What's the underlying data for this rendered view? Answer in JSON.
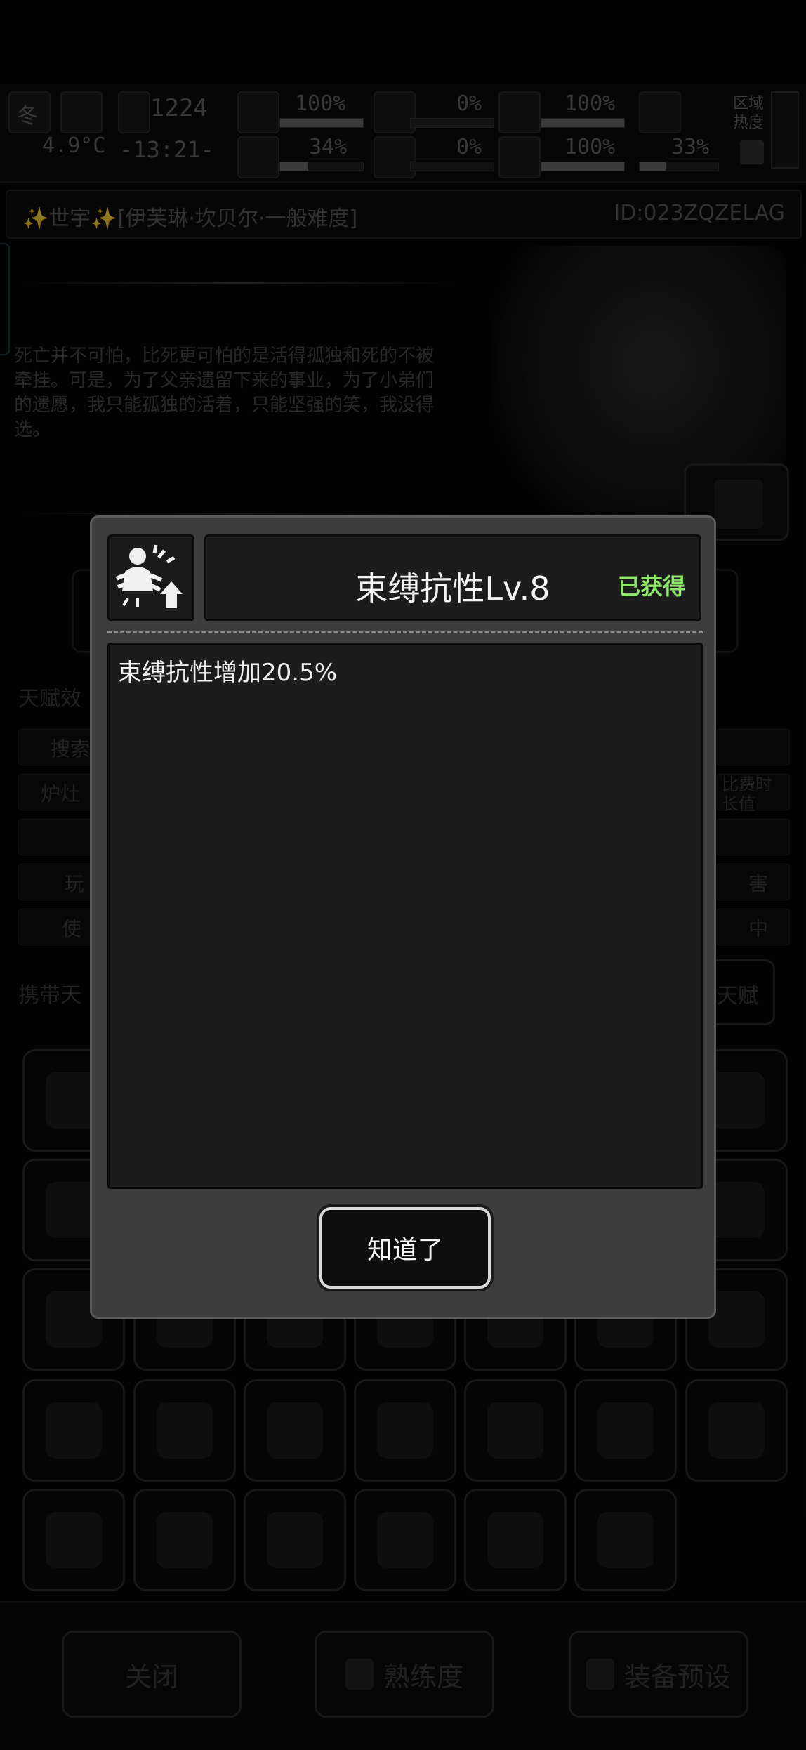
{
  "hud": {
    "season": "冬",
    "temperature": "4.9°C",
    "day": "1224",
    "time": "-13:21-",
    "stats_row1": [
      "100%",
      "0%",
      "100%"
    ],
    "stats_row2": [
      "34%",
      "0%",
      "100%",
      "33%"
    ],
    "region_heat_label": "区域热度",
    "levels": {
      "health": 1.0,
      "hunger": 0.0,
      "stamina": 1.0,
      "mental": 0.34,
      "blood": 0.0,
      "heart": 1.0,
      "defense": 0.33
    }
  },
  "header": {
    "title": "✨世宇✨[伊芙琳·坎贝尔·一般难度]",
    "player_id": "ID:023ZQZELAG"
  },
  "story": {
    "text": "死亡并不可怕，比死更可怕的是活得孤独和死的不被牵挂。可是，为了父亲遗留下来的事业，为了小弟们的遗愿，我只能孤独的活着，只能坚强的笑，我没得选。"
  },
  "background_labels": {
    "talent_effects": "天赋效",
    "row1": "搜索",
    "row2": "炉灶",
    "row2_right": "比费时长值",
    "row4": "玩",
    "row4_right": "害",
    "row5": "使",
    "row5_right": "中",
    "carried_talents": "携带天",
    "talent_button": "天赋"
  },
  "bottom_bar": {
    "close": "关闭",
    "proficiency": "熟练度",
    "equip_preset": "装备预设"
  },
  "modal": {
    "title": "束缚抗性Lv.8",
    "status": "已获得",
    "description": "束缚抗性增加20.5%",
    "confirm": "知道了"
  },
  "colors": {
    "modal_bg": "#3d3d3d",
    "panel_bg": "#1c1c1c",
    "acquired_green": "#8fe86a",
    "text_white": "#f2f2f2"
  }
}
